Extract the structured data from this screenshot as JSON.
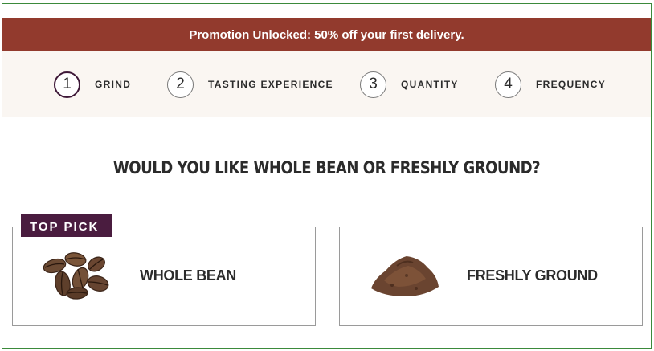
{
  "promo": {
    "text": "Promotion Unlocked: 50% off your first delivery."
  },
  "steps": [
    {
      "number": "1",
      "label": "GRIND"
    },
    {
      "number": "2",
      "label": "TASTING EXPERIENCE"
    },
    {
      "number": "3",
      "label": "QUANTITY"
    },
    {
      "number": "4",
      "label": "FREQUENCY"
    }
  ],
  "question": "WOULD YOU LIKE WHOLE BEAN OR FRESHLY GROUND?",
  "options": [
    {
      "badge": "TOP PICK",
      "title": "WHOLE BEAN",
      "icon": "coffee-beans-image"
    },
    {
      "title": "FRESHLY GROUND",
      "icon": "ground-coffee-image"
    }
  ],
  "colors": {
    "promo_bg": "#923a2d",
    "badge_bg": "#4a1c3f",
    "steps_bg": "#faf6f2",
    "frame_border": "#3b8a3b"
  }
}
